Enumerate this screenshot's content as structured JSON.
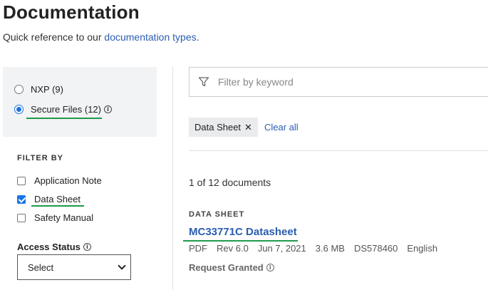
{
  "header": {
    "title": "Documentation",
    "subtitle_prefix": "Quick reference to our ",
    "subtitle_link": "documentation types",
    "subtitle_suffix": "."
  },
  "source": {
    "options": [
      {
        "label": "NXP (9)",
        "checked": false
      },
      {
        "label": "Secure Files (12)",
        "checked": true
      }
    ],
    "info_icon": "info-icon"
  },
  "filters": {
    "heading": "FILTER BY",
    "options": [
      {
        "label": "Application Note",
        "checked": false
      },
      {
        "label": "Data Sheet",
        "checked": true
      },
      {
        "label": "Safety Manual",
        "checked": false
      }
    ]
  },
  "access": {
    "label": "Access Status",
    "selected": "Select"
  },
  "search": {
    "placeholder": "Filter by keyword",
    "icon": "filter-icon"
  },
  "active_filters": {
    "chips": [
      {
        "label": "Data Sheet",
        "remove_glyph": "✕"
      }
    ],
    "clear_label": "Clear all"
  },
  "results": {
    "count_text": "1 of 12 documents",
    "items": [
      {
        "type": "DATA SHEET",
        "title": "MC33771C Datasheet",
        "format": "PDF",
        "rev": "Rev 6.0",
        "date": "Jun 7, 2021",
        "size": "3.6 MB",
        "doc_id": "DS578460",
        "language": "English",
        "status": "Request Granted"
      }
    ]
  },
  "colors": {
    "accent": "#1a73e8",
    "link": "#2a5db0",
    "highlight_underline": "#1f9a4b"
  }
}
